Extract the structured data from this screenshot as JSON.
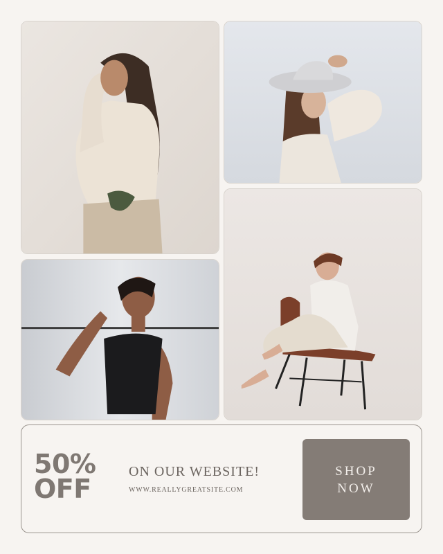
{
  "colors": {
    "background": "#f7f4f1",
    "accent": "#847c76",
    "text": "#7f7873"
  },
  "photos": [
    {
      "name": "woman in cream knit top and beige trousers"
    },
    {
      "name": "woman in wide-brim hat and cream sweater"
    },
    {
      "name": "woman in black tank top"
    },
    {
      "name": "woman in white outfit on brown chair"
    }
  ],
  "promo": {
    "discount_line1": "50%",
    "discount_line2": "OFF",
    "headline": "ON OUR WEBSITE!",
    "website": "WWW.REALLYGREATSITE.COM",
    "cta_line1": "SHOP",
    "cta_line2": "NOW"
  }
}
